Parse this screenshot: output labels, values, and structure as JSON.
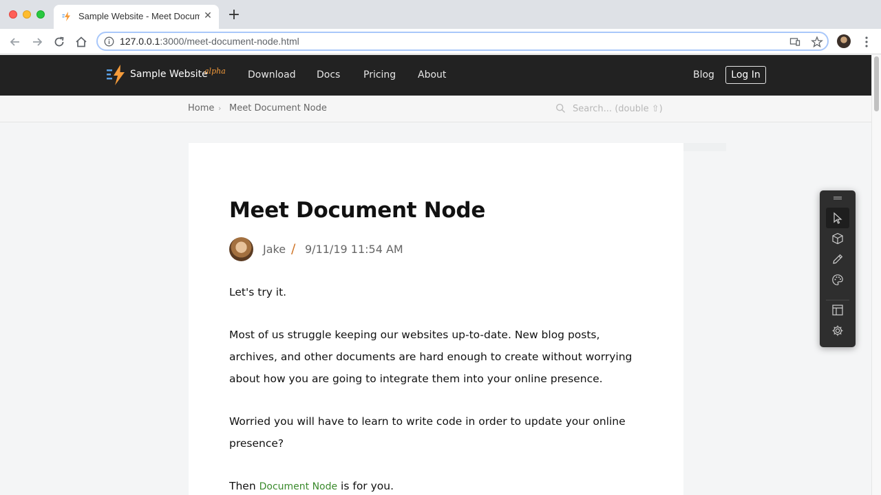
{
  "browser": {
    "tab_title": "Sample Website - Meet Docum",
    "url_host": "127.0.0.1",
    "url_path": ":3000/meet-document-node.html"
  },
  "site": {
    "brand": "Sample Website",
    "brand_tag": "alpha",
    "nav": [
      "Download",
      "Docs",
      "Pricing",
      "About"
    ],
    "blog_label": "Blog",
    "login_label": "Log In"
  },
  "breadcrumb": {
    "home": "Home",
    "current": "Meet Document Node"
  },
  "search": {
    "placeholder": "Search... (double ⇧)"
  },
  "article": {
    "title": "Meet Document Node",
    "author": "Jake",
    "separator": "/",
    "date": "9/11/19 11:54 AM",
    "p1": "Let's try it.",
    "p2": "Most of us struggle keeping our websites up-to-date. New blog posts, archives, and other documents are hard enough to create without worrying about how you are going to integrate them into your online presence.",
    "p3": "Worried you will have to learn to write code in order to update your online presence?",
    "p4_before": "Then ",
    "p4_link": "Document Node",
    "p4_after": " is for you."
  },
  "editor_tools": [
    "cursor-icon",
    "cube-icon",
    "pencil-icon",
    "palette-icon",
    "layout-icon",
    "gear-icon"
  ],
  "colors": {
    "header_bg": "#222222",
    "accent": "#f59b3a",
    "link": "#3a8a2c"
  }
}
